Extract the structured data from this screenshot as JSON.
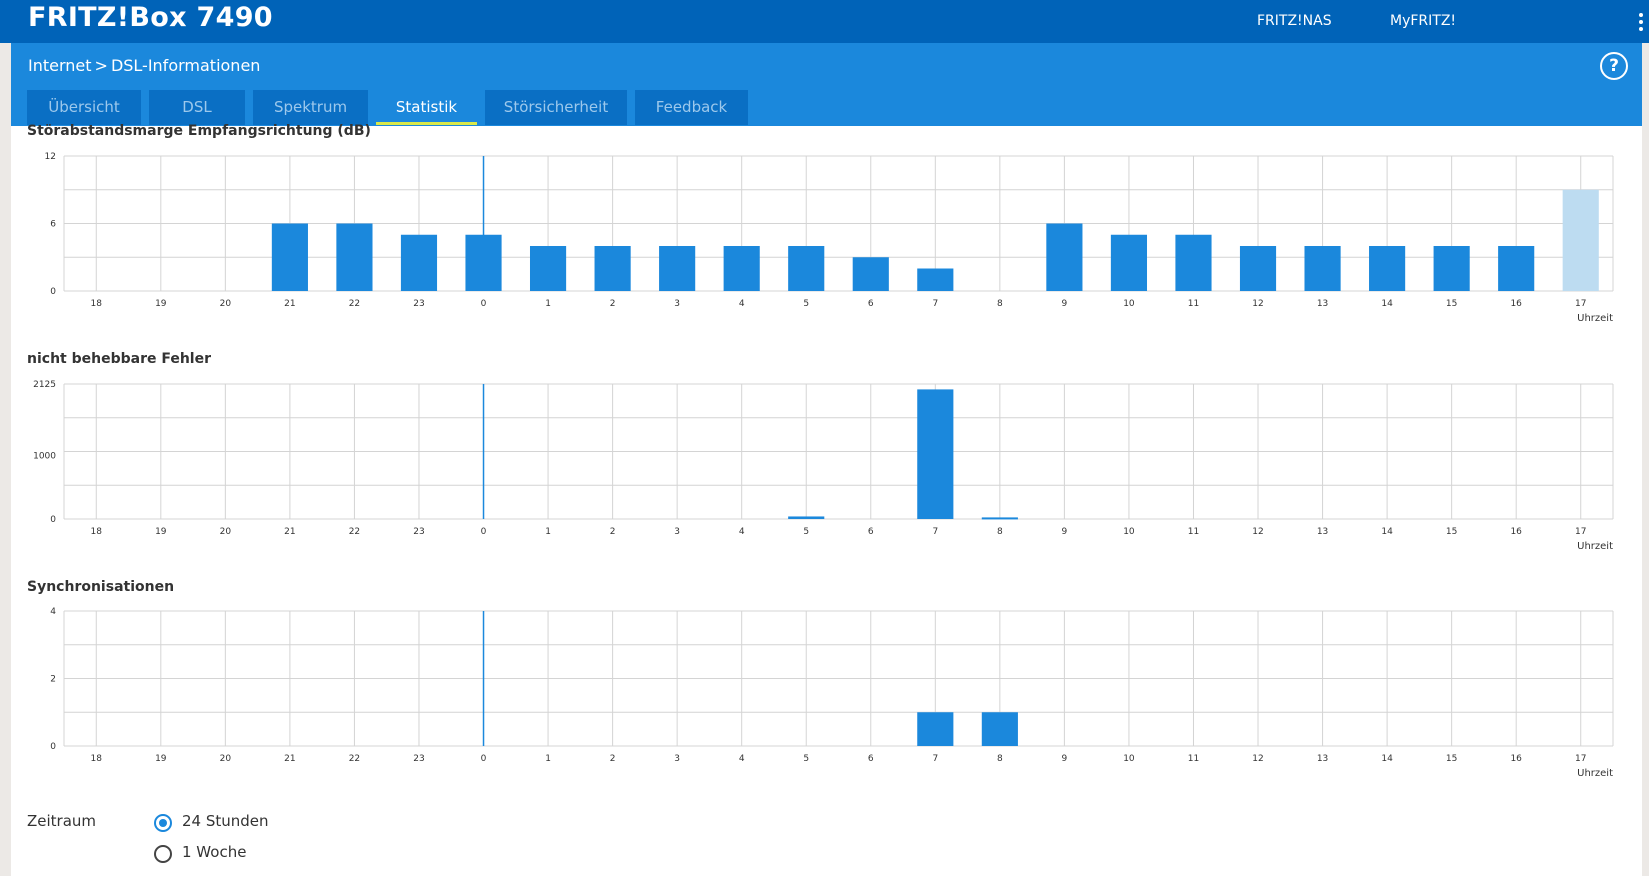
{
  "header": {
    "brand": "FRITZ!Box 7490",
    "links": [
      "FRITZ!NAS",
      "MyFRITZ!"
    ]
  },
  "breadcrumb": {
    "parent": "Internet",
    "separator": ">",
    "current": "DSL-Informationen"
  },
  "help": {
    "label": "?"
  },
  "tabs": [
    {
      "label": "Übersicht",
      "active": false
    },
    {
      "label": "DSL",
      "active": false
    },
    {
      "label": "Spektrum",
      "active": false
    },
    {
      "label": "Statistik",
      "active": true
    },
    {
      "label": "Störsicherheit",
      "active": false
    },
    {
      "label": "Feedback",
      "active": false
    }
  ],
  "colors": {
    "bar": "#1b88dc",
    "bar_current": "#bddcf1",
    "grid": "#d4d4d4",
    "header": "#0063b8",
    "subheader": "#1b88dc"
  },
  "chart_data": [
    {
      "type": "bar",
      "title": "Störabstandsmarge Empfangsrichtung (dB)",
      "xlabel": "Uhrzeit",
      "categories": [
        "18",
        "19",
        "20",
        "21",
        "22",
        "23",
        "0",
        "1",
        "2",
        "3",
        "4",
        "5",
        "6",
        "7",
        "8",
        "9",
        "10",
        "11",
        "12",
        "13",
        "14",
        "15",
        "16",
        "17"
      ],
      "values": [
        0,
        0,
        0,
        6,
        6,
        5,
        5,
        4,
        4,
        4,
        4,
        4,
        3,
        2,
        0,
        6,
        5,
        5,
        4,
        4,
        4,
        4,
        4,
        9
      ],
      "highlight_last": true,
      "yticks": [
        0,
        6,
        12
      ],
      "ylim": [
        0,
        12
      ]
    },
    {
      "type": "bar",
      "title": "nicht behebbare Fehler",
      "xlabel": "Uhrzeit",
      "categories": [
        "18",
        "19",
        "20",
        "21",
        "22",
        "23",
        "0",
        "1",
        "2",
        "3",
        "4",
        "5",
        "6",
        "7",
        "8",
        "9",
        "10",
        "11",
        "12",
        "13",
        "14",
        "15",
        "16",
        "17"
      ],
      "values": [
        0,
        0,
        0,
        0,
        0,
        0,
        0,
        0,
        0,
        0,
        0,
        40,
        0,
        2040,
        25,
        0,
        0,
        0,
        0,
        0,
        0,
        0,
        0,
        0
      ],
      "highlight_last": false,
      "yticks": [
        0,
        1000,
        2125
      ],
      "ylim": [
        0,
        2125
      ]
    },
    {
      "type": "bar",
      "title": "Synchronisationen",
      "xlabel": "Uhrzeit",
      "categories": [
        "18",
        "19",
        "20",
        "21",
        "22",
        "23",
        "0",
        "1",
        "2",
        "3",
        "4",
        "5",
        "6",
        "7",
        "8",
        "9",
        "10",
        "11",
        "12",
        "13",
        "14",
        "15",
        "16",
        "17"
      ],
      "values": [
        0,
        0,
        0,
        0,
        0,
        0,
        0,
        0,
        0,
        0,
        0,
        0,
        0,
        1,
        1,
        0,
        0,
        0,
        0,
        0,
        0,
        0,
        0,
        0
      ],
      "highlight_last": false,
      "yticks": [
        0,
        2,
        4
      ],
      "ylim": [
        0,
        4
      ]
    }
  ],
  "zeitraum": {
    "label": "Zeitraum",
    "options": [
      {
        "label": "24 Stunden",
        "checked": true
      },
      {
        "label": "1 Woche",
        "checked": false
      }
    ]
  }
}
